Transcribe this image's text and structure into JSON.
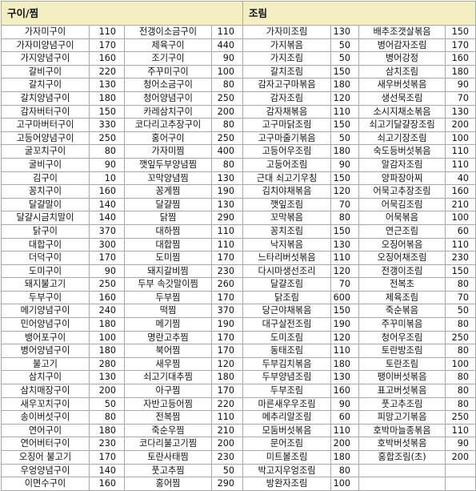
{
  "headers": {
    "grill": "구이/찜",
    "braise": "조림"
  },
  "columns": [
    {
      "name": "가자미구이",
      "cal": "110"
    },
    {
      "name": "가자미양념구이",
      "cal": "170"
    },
    {
      "name": "가지양념구이",
      "cal": "160"
    },
    {
      "name": "갈비구이",
      "cal": "220"
    },
    {
      "name": "갈치구이",
      "cal": "130"
    },
    {
      "name": "갈치양념구이",
      "cal": "180"
    },
    {
      "name": "감자버터구이",
      "cal": "150"
    },
    {
      "name": "고구마버터구이",
      "cal": "330"
    },
    {
      "name": "고등어양념구이",
      "cal": "250"
    },
    {
      "name": "굴꼬치구이",
      "cal": "80"
    },
    {
      "name": "굴비구이",
      "cal": "90"
    },
    {
      "name": "김구이",
      "cal": "10"
    },
    {
      "name": "꽁치구이",
      "cal": "160"
    },
    {
      "name": "달걀말이",
      "cal": "140"
    },
    {
      "name": "달걀시금치말이",
      "cal": "140"
    },
    {
      "name": "닭구이",
      "cal": "370"
    },
    {
      "name": "대합구이",
      "cal": "300"
    },
    {
      "name": "더덕구이",
      "cal": "170"
    },
    {
      "name": "도미구이",
      "cal": "90"
    },
    {
      "name": "돼지불고기",
      "cal": "250"
    },
    {
      "name": "두부구이",
      "cal": "160"
    },
    {
      "name": "메기양념구이",
      "cal": "240"
    },
    {
      "name": "민어양념구이",
      "cal": "180"
    },
    {
      "name": "뱅어포구이",
      "cal": "100"
    },
    {
      "name": "병어양념구이",
      "cal": "180"
    },
    {
      "name": "불고기",
      "cal": "280"
    },
    {
      "name": "삼치구이",
      "cal": "130"
    },
    {
      "name": "삼치매장구이",
      "cal": "200"
    },
    {
      "name": "새우꼬치구이",
      "cal": "50"
    },
    {
      "name": "송이버섯구이",
      "cal": "80"
    },
    {
      "name": "연어구이",
      "cal": "180"
    },
    {
      "name": "연어버터구이",
      "cal": "230"
    },
    {
      "name": "오징어 불고기",
      "cal": "170"
    },
    {
      "name": "우엉양념구이",
      "cal": "140"
    },
    {
      "name": "이면수구이",
      "cal": "160"
    },
    {
      "name": "전갱이소금구이",
      "cal": "110"
    },
    {
      "name": "제육구이",
      "cal": "440"
    },
    {
      "name": "조기구이",
      "cal": "90"
    },
    {
      "name": "주꾸미구이",
      "cal": "100"
    },
    {
      "name": "청어소금구이",
      "cal": "80"
    },
    {
      "name": "청어양념구이",
      "cal": "250"
    },
    {
      "name": "카레삼치구이",
      "cal": "200"
    },
    {
      "name": "코다리고추장구이",
      "cal": "80"
    },
    {
      "name": "홍어구이",
      "cal": "250"
    },
    {
      "name": "가자미찜",
      "cal": "400"
    },
    {
      "name": "깻잎두부양념찜",
      "cal": "80"
    },
    {
      "name": "꼬막양념찜",
      "cal": "130"
    },
    {
      "name": "꽁게찜",
      "cal": "190"
    },
    {
      "name": "달걀찜",
      "cal": "130"
    },
    {
      "name": "닭찜",
      "cal": "290"
    },
    {
      "name": "대하찜",
      "cal": "110"
    },
    {
      "name": "대합찜",
      "cal": "110"
    },
    {
      "name": "도미찜",
      "cal": "170"
    },
    {
      "name": "돼지갈비찜",
      "cal": "230"
    },
    {
      "name": "두부 속갓말이찜",
      "cal": "260"
    },
    {
      "name": "두부찜",
      "cal": "170"
    },
    {
      "name": "떡찜",
      "cal": "370"
    },
    {
      "name": "메기찜",
      "cal": "190"
    },
    {
      "name": "명란고추찜",
      "cal": "170"
    },
    {
      "name": "북어찜",
      "cal": "170"
    },
    {
      "name": "새우찜",
      "cal": "120"
    },
    {
      "name": "쇠고기대추찜",
      "cal": "180"
    },
    {
      "name": "아구찜",
      "cal": "170"
    },
    {
      "name": "자반고등어찜",
      "cal": "220"
    },
    {
      "name": "전복찜",
      "cal": "110"
    },
    {
      "name": "죽순우찜",
      "cal": "210"
    },
    {
      "name": "코다리불고기찜",
      "cal": "200"
    },
    {
      "name": "토란사태찜",
      "cal": "230"
    },
    {
      "name": "풋고추찜",
      "cal": "50"
    },
    {
      "name": "홍어찜",
      "cal": "290"
    },
    {
      "name": "가자미조림",
      "cal": "130"
    },
    {
      "name": "가지볶음",
      "cal": "50"
    },
    {
      "name": "가지조림",
      "cal": "50"
    },
    {
      "name": "갈치조림",
      "cal": "150"
    },
    {
      "name": "감자고구마볶음",
      "cal": "180"
    },
    {
      "name": "감자조림",
      "cal": "120"
    },
    {
      "name": "감자채볶음",
      "cal": "110"
    },
    {
      "name": "고구마닭조림",
      "cal": "150"
    },
    {
      "name": "고구마줄기볶음",
      "cal": "50"
    },
    {
      "name": "고등어우조림",
      "cal": "180"
    },
    {
      "name": "고등어조림",
      "cal": "90"
    },
    {
      "name": "근대 쇠고기우칭",
      "cal": "150"
    },
    {
      "name": "김치야채볶음",
      "cal": "120"
    },
    {
      "name": "깻잎조림",
      "cal": "70"
    },
    {
      "name": "꼬막볶음",
      "cal": "80"
    },
    {
      "name": "꽁치조림",
      "cal": "150"
    },
    {
      "name": "낙지볶음",
      "cal": "130"
    },
    {
      "name": "느타리버섯볶음",
      "cal": "110"
    },
    {
      "name": "다시마생선조리",
      "cal": "120"
    },
    {
      "name": "달걀조림",
      "cal": "70"
    },
    {
      "name": "닭조림",
      "cal": "600"
    },
    {
      "name": "당근야채볶음",
      "cal": "150"
    },
    {
      "name": "대구살전조림",
      "cal": "190"
    },
    {
      "name": "도미조림",
      "cal": "120"
    },
    {
      "name": "동태조림",
      "cal": "110"
    },
    {
      "name": "두부김치볶음",
      "cal": "180"
    },
    {
      "name": "두부양념조림",
      "cal": "130"
    },
    {
      "name": "두부조림",
      "cal": "160"
    },
    {
      "name": "마른새우우조림",
      "cal": "90"
    },
    {
      "name": "메추리알조림",
      "cal": "60"
    },
    {
      "name": "모둠버섯볶음",
      "cal": "110"
    },
    {
      "name": "문어조림",
      "cal": "200"
    },
    {
      "name": "미트볼조림",
      "cal": "180"
    },
    {
      "name": "박고지우엉조림",
      "cal": "80"
    },
    {
      "name": "방완자조림",
      "cal": "100"
    },
    {
      "name": "배추조갯살볶음",
      "cal": "150"
    },
    {
      "name": "병어감자조림",
      "cal": "170"
    },
    {
      "name": "병어강정",
      "cal": "160"
    },
    {
      "name": "삼치조림",
      "cal": "180"
    },
    {
      "name": "새우버섯볶음",
      "cal": "90"
    },
    {
      "name": "생선묵조림",
      "cal": "70"
    },
    {
      "name": "소시지채소볶음",
      "cal": "130"
    },
    {
      "name": "쇠고기달걀장조림",
      "cal": "200"
    },
    {
      "name": "쇠고기장조림",
      "cal": "100"
    },
    {
      "name": "숙도등버섯볶음",
      "cal": "110"
    },
    {
      "name": "알감자조림",
      "cal": "110"
    },
    {
      "name": "양파장아찌",
      "cal": "40"
    },
    {
      "name": "어묵고추장조림",
      "cal": "160"
    },
    {
      "name": "어묵김조림",
      "cal": "210"
    },
    {
      "name": "어묵볶음",
      "cal": "100"
    },
    {
      "name": "연근조림",
      "cal": "60"
    },
    {
      "name": "오징어볶음",
      "cal": "110"
    },
    {
      "name": "오징어채조림",
      "cal": "230"
    },
    {
      "name": "전갱이조림",
      "cal": "150"
    },
    {
      "name": "전복초",
      "cal": "80"
    },
    {
      "name": "제육조림",
      "cal": "70"
    },
    {
      "name": "죽순볶음",
      "cal": "50"
    },
    {
      "name": "주꾸미볶음",
      "cal": "80"
    },
    {
      "name": "청어우조림",
      "cal": "250"
    },
    {
      "name": "토란방조림",
      "cal": "80"
    },
    {
      "name": "토란조림",
      "cal": "100"
    },
    {
      "name": "팽이버섯볶음",
      "cal": "80"
    },
    {
      "name": "표고버섯볶음",
      "cal": "80"
    },
    {
      "name": "풋고추조림",
      "cal": "80"
    },
    {
      "name": "피망고기볶음",
      "cal": "250"
    },
    {
      "name": "호박마늘종볶음",
      "cal": "110"
    },
    {
      "name": "호박버섯볶음",
      "cal": "90"
    },
    {
      "name": "홍합조림(초)",
      "cal": "200"
    }
  ]
}
